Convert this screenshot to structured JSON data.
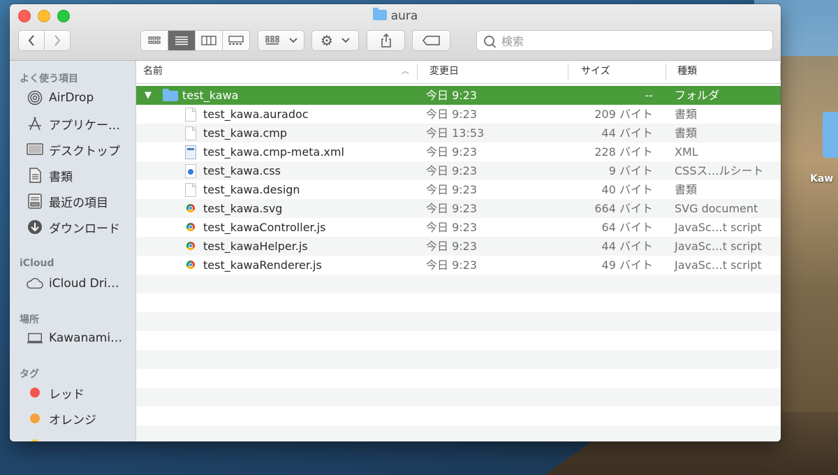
{
  "window": {
    "title": "aura"
  },
  "toolbar": {
    "back_icon": "chevron-left-icon",
    "forward_icon": "chevron-right-icon",
    "view_modes": [
      "icon-view-icon",
      "list-view-icon",
      "column-view-icon",
      "gallery-view-icon"
    ],
    "active_view": 1,
    "search_placeholder": "検索"
  },
  "sidebar": {
    "favorites_title": "よく使う項目",
    "favorites": [
      {
        "label": "AirDrop",
        "icon": "airdrop-icon"
      },
      {
        "label": "アプリケー…",
        "icon": "applications-icon"
      },
      {
        "label": "デスクトップ",
        "icon": "desktop-icon"
      },
      {
        "label": "書類",
        "icon": "documents-icon"
      },
      {
        "label": "最近の項目",
        "icon": "recents-icon"
      },
      {
        "label": "ダウンロード",
        "icon": "downloads-icon"
      }
    ],
    "icloud_title": "iCloud",
    "icloud": [
      {
        "label": "iCloud Dri…",
        "icon": "cloud-icon"
      }
    ],
    "locations_title": "場所",
    "locations": [
      {
        "label": "Kawanami…",
        "icon": "laptop-icon"
      }
    ],
    "tags_title": "タグ",
    "tags": [
      {
        "label": "レッド",
        "color": "#f25550"
      },
      {
        "label": "オレンジ",
        "color": "#f5a03a"
      }
    ]
  },
  "list": {
    "columns": {
      "name": "名前",
      "date": "変更日",
      "size": "サイズ",
      "kind": "種類"
    },
    "folder": {
      "name": "test_kawa",
      "date": "今日 9:23",
      "size": "--",
      "kind": "フォルダ"
    },
    "files": [
      {
        "name": "test_kawa.auradoc",
        "date": "今日 9:23",
        "size": "209 バイト",
        "kind": "書類",
        "icon": "document-icon"
      },
      {
        "name": "test_kawa.cmp",
        "date": "今日 13:53",
        "size": "44 バイト",
        "kind": "書類",
        "icon": "document-icon"
      },
      {
        "name": "test_kawa.cmp-meta.xml",
        "date": "今日 9:23",
        "size": "228 バイト",
        "kind": "XML",
        "icon": "xml-file-icon"
      },
      {
        "name": "test_kawa.css",
        "date": "今日 9:23",
        "size": "9 バイト",
        "kind": "CSSス…ルシート",
        "icon": "css-file-icon"
      },
      {
        "name": "test_kawa.design",
        "date": "今日 9:23",
        "size": "40 バイト",
        "kind": "書類",
        "icon": "document-icon"
      },
      {
        "name": "test_kawa.svg",
        "date": "今日 9:23",
        "size": "664 バイト",
        "kind": "SVG document",
        "icon": "chrome-file-icon"
      },
      {
        "name": "test_kawaController.js",
        "date": "今日 9:23",
        "size": "64 バイト",
        "kind": "JavaSc…t script",
        "icon": "chrome-file-icon"
      },
      {
        "name": "test_kawaHelper.js",
        "date": "今日 9:23",
        "size": "44 バイト",
        "kind": "JavaSc…t script",
        "icon": "chrome-file-icon"
      },
      {
        "name": "test_kawaRenderer.js",
        "date": "今日 9:23",
        "size": "49 バイト",
        "kind": "JavaSc…t script",
        "icon": "chrome-file-icon"
      }
    ]
  },
  "desktop": {
    "folder_label": "Kaw"
  }
}
